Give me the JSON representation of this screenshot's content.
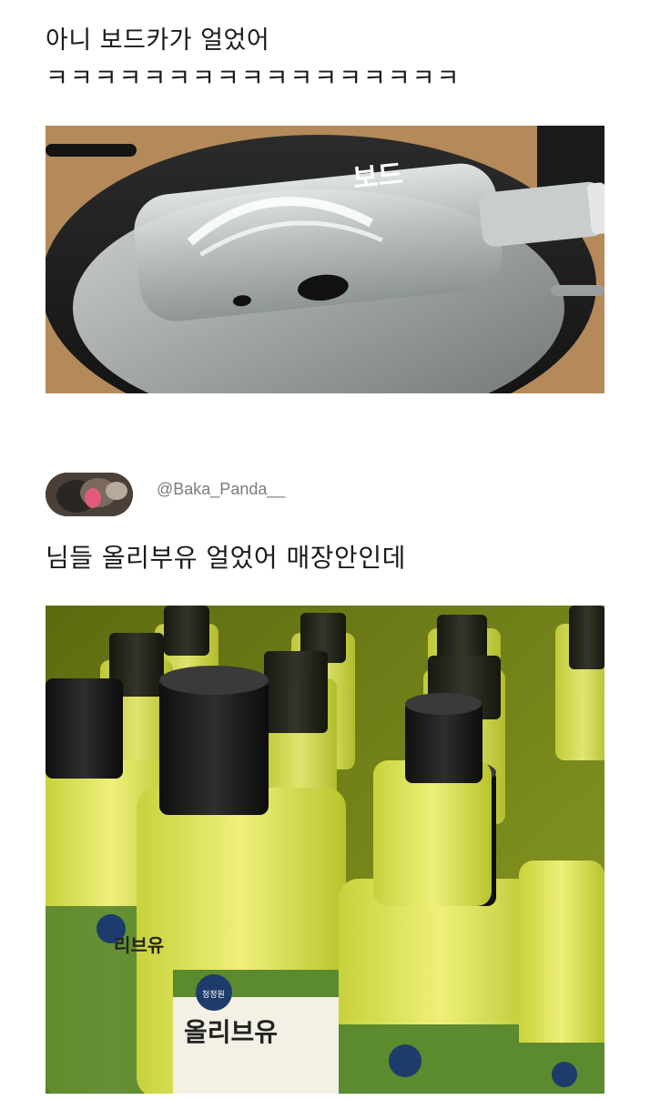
{
  "post": {
    "line1": "아니 보드카가 얼었어",
    "line2": "ㅋㅋㅋㅋㅋㅋㅋㅋㅋㅋㅋㅋㅋㅋㅋㅋㅋ"
  },
  "tweet": {
    "handle": "@Baka_Panda__",
    "text": "님들 올리부유 얼었어 매장안인데"
  },
  "images": {
    "vodka_bottle_label": "보드",
    "oil_label_big": "올리브유",
    "oil_label_small": "리브유",
    "brand_mark": "청정원"
  },
  "colors": {
    "oil_yellow": "#d9e04a",
    "label_green": "#4f7f2a",
    "cap_black": "#1a1a1a"
  }
}
